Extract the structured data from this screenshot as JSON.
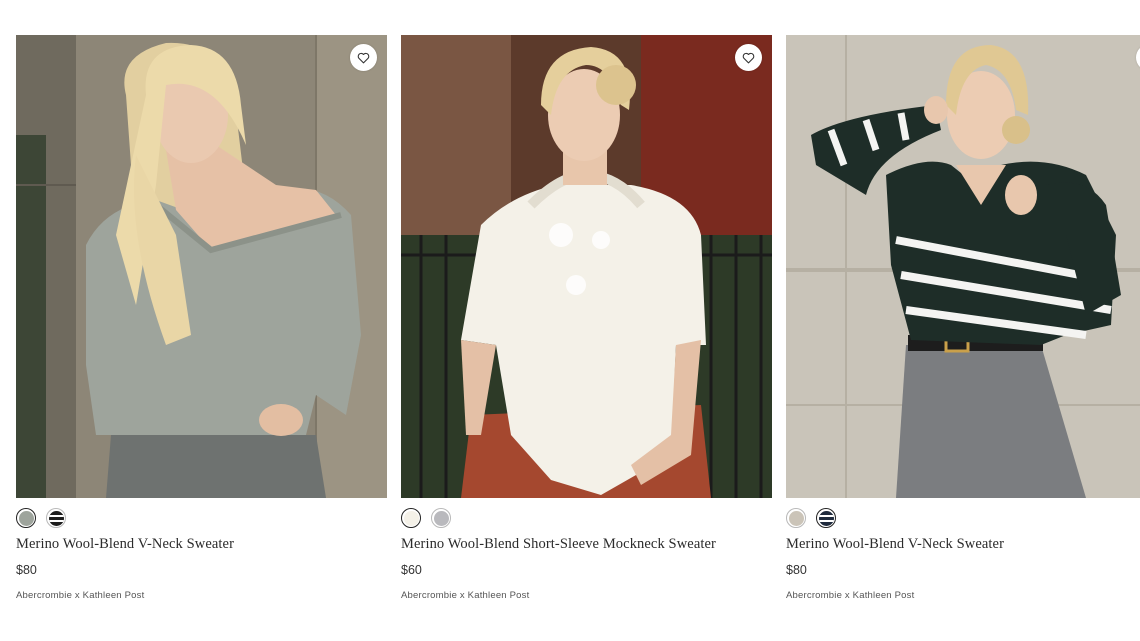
{
  "products": [
    {
      "name": "Merino Wool-Blend V-Neck Sweater",
      "price": "$80",
      "brand": "Abercrombie x Kathleen Post",
      "image_alt": "Woman in sage off-shoulder v-neck sweater",
      "swatches": [
        {
          "name": "sage",
          "color": "#9ea49c",
          "selected": true
        },
        {
          "name": "black-stripe",
          "color": "striped",
          "selected": false
        }
      ]
    },
    {
      "name": "Merino Wool-Blend Short-Sleeve Mockneck Sweater",
      "price": "$60",
      "brand": "Abercrombie x Kathleen Post",
      "image_alt": "Woman in cream short-sleeve mockneck sweater",
      "swatches": [
        {
          "name": "cream",
          "color": "#f4f1e8",
          "selected": true
        },
        {
          "name": "light-grey",
          "color": "#b9b9bd",
          "selected": false
        }
      ]
    },
    {
      "name": "Merino Wool-Blend V-Neck Sweater",
      "price": "$80",
      "brand": "Abercrombie x Kathleen Post",
      "image_alt": "Woman in dark green striped v-neck sweater",
      "swatches": [
        {
          "name": "oatmeal",
          "color": "#cbc4b8",
          "selected": false
        },
        {
          "name": "navy-stripe",
          "color": "striped",
          "selected": true
        }
      ]
    }
  ],
  "icons": {
    "favorite": "heart-outline-icon"
  },
  "colors": {
    "text": "#2b2b2b",
    "background": "#ffffff"
  }
}
